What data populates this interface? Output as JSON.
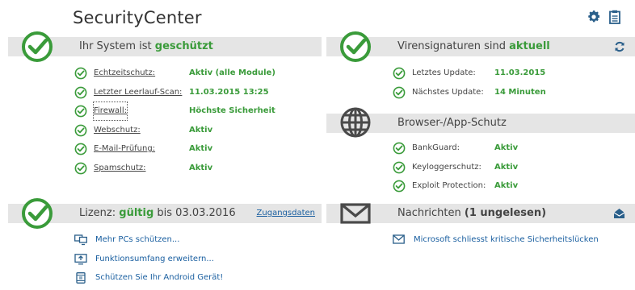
{
  "app": {
    "title": "SecurityCenter"
  },
  "colors": {
    "accent_green": "#3a9b3a",
    "header_gray": "#e5e5e5",
    "link_blue": "#1a5fa0",
    "icon_gray": "#4a4a4a"
  },
  "top_icons": [
    "gear-icon",
    "clipboard-icon"
  ],
  "system": {
    "header_prefix": "Ihr System ist ",
    "header_status": "geschützt",
    "items": [
      {
        "label": "Echtzeitschutz:",
        "value": "Aktiv (alle Module)"
      },
      {
        "label": "Letzter Leerlauf-Scan:",
        "value": "11.03.2015 13:25"
      },
      {
        "label": "Firewall:",
        "value": "Höchste Sicherheit"
      },
      {
        "label": "Webschutz:",
        "value": "Aktiv"
      },
      {
        "label": "E-Mail-Prüfung:",
        "value": "Aktiv"
      },
      {
        "label": "Spamschutz:",
        "value": "Aktiv"
      }
    ]
  },
  "signatures": {
    "header_prefix": "Virensignaturen sind ",
    "header_status": "aktuell",
    "items": [
      {
        "label": "Letztes Update:",
        "value": "11.03.2015"
      },
      {
        "label": "Nächstes Update:",
        "value": "14 Minuten"
      }
    ]
  },
  "browser": {
    "header": "Browser-/App-Schutz",
    "items": [
      {
        "label": "BankGuard:",
        "value": "Aktiv"
      },
      {
        "label": "Keyloggerschutz:",
        "value": "Aktiv"
      },
      {
        "label": "Exploit Protection:",
        "value": "Aktiv"
      }
    ]
  },
  "license": {
    "prefix": "Lizenz: ",
    "status": "gültig",
    "suffix": " bis 03.03.2016",
    "access_link": "Zugangsdaten",
    "links": [
      {
        "icon": "computers-icon",
        "label": "Mehr PCs schützen..."
      },
      {
        "icon": "monitor-upgrade-icon",
        "label": "Funktionsumfang erweitern..."
      },
      {
        "icon": "android-device-icon",
        "label": "Schützen Sie Ihr Android Gerät!"
      }
    ]
  },
  "messages": {
    "prefix": "Nachrichten ",
    "count_label": "(1 ungelesen)",
    "items": [
      {
        "icon": "envelope-icon",
        "label": "Microsoft schliesst kritische Sicherheitslücken"
      }
    ]
  }
}
